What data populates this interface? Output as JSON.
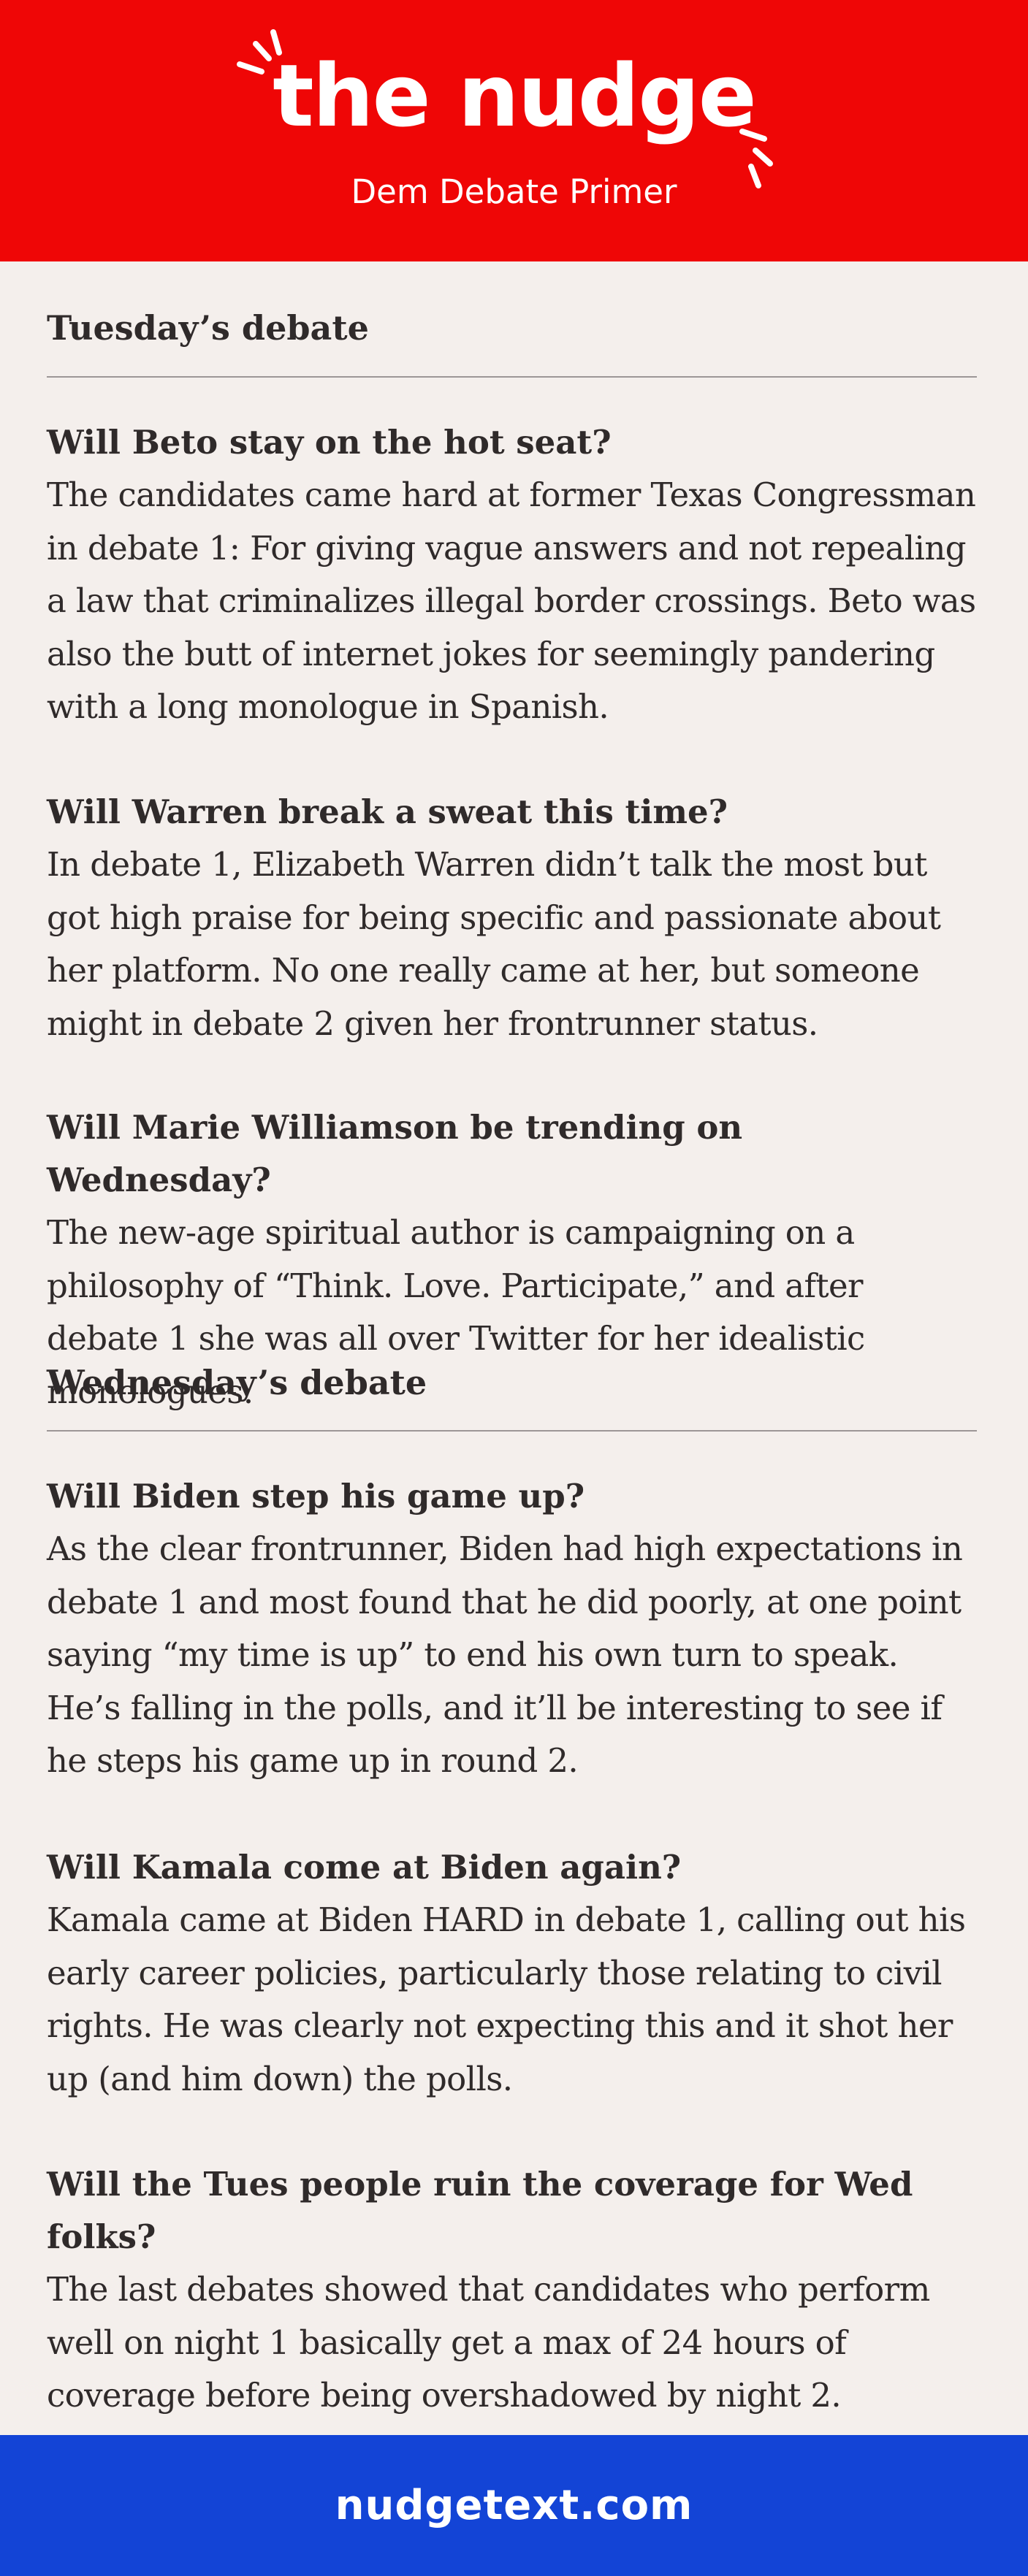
{
  "header": {
    "brand": "the nudge",
    "subtitle": "Dem Debate Primer",
    "background": "#ef0606"
  },
  "sections": [
    {
      "title": "Tuesday’s debate",
      "questions": [
        {
          "title": "Will Beto stay on the hot seat?",
          "body": "The candidates came hard at former Texas Congressman in debate 1: For giving vague answers and not repealing a law that criminalizes illegal border crossings. Beto was also the butt of internet jokes for seemingly pandering with a long monologue in Spanish."
        },
        {
          "title": "Will Warren break a sweat this time?",
          "body": "In debate 1, Elizabeth Warren didn’t talk the most but got high praise for being specific and passionate about her platform. No one really came at her, but someone might in debate 2 given her frontrunner status."
        },
        {
          "title": "Will Marie Williamson be trending on Wednesday?",
          "body": "The new-age spiritual author is campaigning on a philosophy of “Think. Love. Participate,” and after debate 1 she was all over Twitter for her idealistic monologues."
        }
      ]
    },
    {
      "title": "Wednesday’s debate",
      "questions": [
        {
          "title": "Will Biden step his game up?",
          "body": "As the clear frontrunner, Biden had high expectations in debate 1 and most found that he did poorly, at one point saying “my time is up” to end his own turn to speak. He’s falling in the polls, and it’ll be interesting to see if he steps his game up in round 2."
        },
        {
          "title": "Will Kamala come at Biden again?",
          "body": "Kamala came at Biden HARD in debate 1, calling out his early career policies, particularly those relating to civil rights. He was clearly not expecting this and it shot her up (and him down) the polls."
        },
        {
          "title": "Will the Tues people ruin the coverage for Wed folks?",
          "body": "The last debates showed that candidates who perform well on night 1 basically get a max of 24 hours of coverage before being overshadowed by night 2."
        }
      ]
    }
  ],
  "footer": {
    "url": "nudgetext.com",
    "background": "#1344d6"
  }
}
